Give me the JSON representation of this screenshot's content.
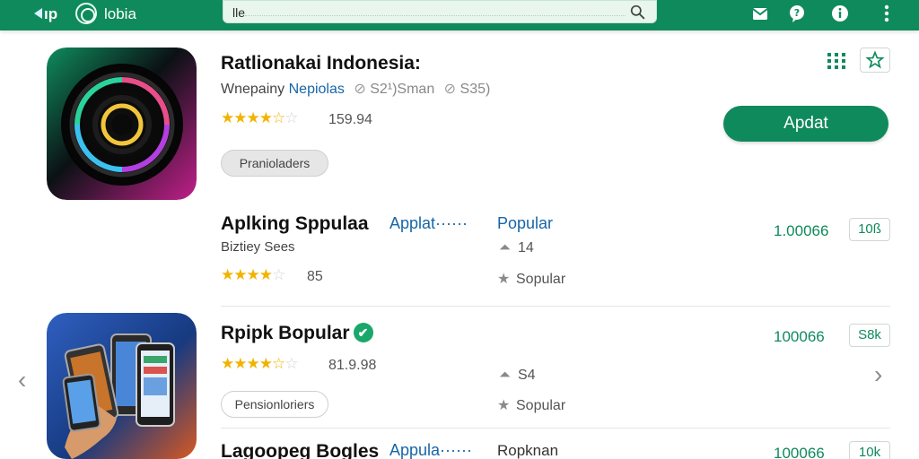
{
  "topbar": {
    "back_label": "ıp",
    "brand": "lobia",
    "search_value": "lle",
    "icons": [
      "mail-icon",
      "chat-icon",
      "info-icon",
      "more-vertical-icon"
    ]
  },
  "featured": {
    "title": "Ratlionakai Indonesia:",
    "developer": "Wnepainy",
    "category": "Nepiolas",
    "stat1": "S2¹)Sman",
    "stat2": "S35)",
    "rating_value": "159.94",
    "rating_stars": 3.5,
    "chip": "Pranioladers",
    "update_label": "Apdat"
  },
  "apps": [
    {
      "title": "Aplking Sppulaa",
      "subtitle": "Biztiey Sees",
      "tag": "Applat······",
      "tag2": "Popular",
      "meta1": "14",
      "meta2": "Sopular",
      "rating_value": "85",
      "rating_stars": 4,
      "count": "1.00066",
      "badge": "10ß"
    },
    {
      "title": "Rpipk Bopular",
      "verified": true,
      "rating_value": "81.9.98",
      "rating_stars": 3.5,
      "chip": "Pensionloriers",
      "meta1": "S4",
      "meta2": "Sopular",
      "count": "100066",
      "badge": "S8k"
    },
    {
      "title": "Lagoopeg Bogles",
      "tag": "Appula······",
      "tag2": "Ropknan",
      "count": "100066",
      "badge": "10k"
    }
  ],
  "colors": {
    "accent": "#0f8a5c",
    "link_blue": "#1765a8",
    "star": "#f2b300"
  }
}
